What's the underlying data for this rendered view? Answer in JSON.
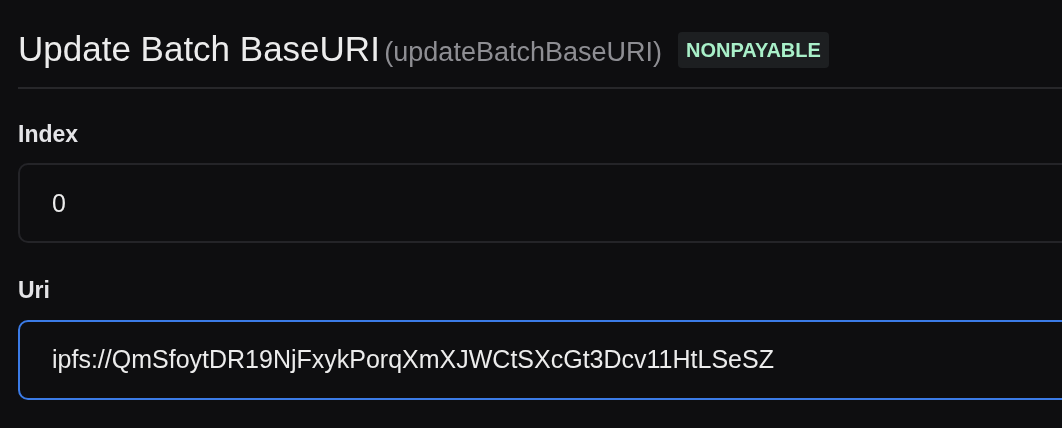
{
  "function": {
    "title": "Update Batch BaseURI",
    "name": "(updateBatchBaseURI)",
    "mutability": "NONPAYABLE"
  },
  "fields": [
    {
      "label": "Index",
      "value": "0",
      "focused": false
    },
    {
      "label": "Uri",
      "value": "ipfs://QmSfoytDR19NjFxykPorqXmXJWCtSXcGt3Dcv11HtLSeSZ",
      "focused": true
    }
  ]
}
